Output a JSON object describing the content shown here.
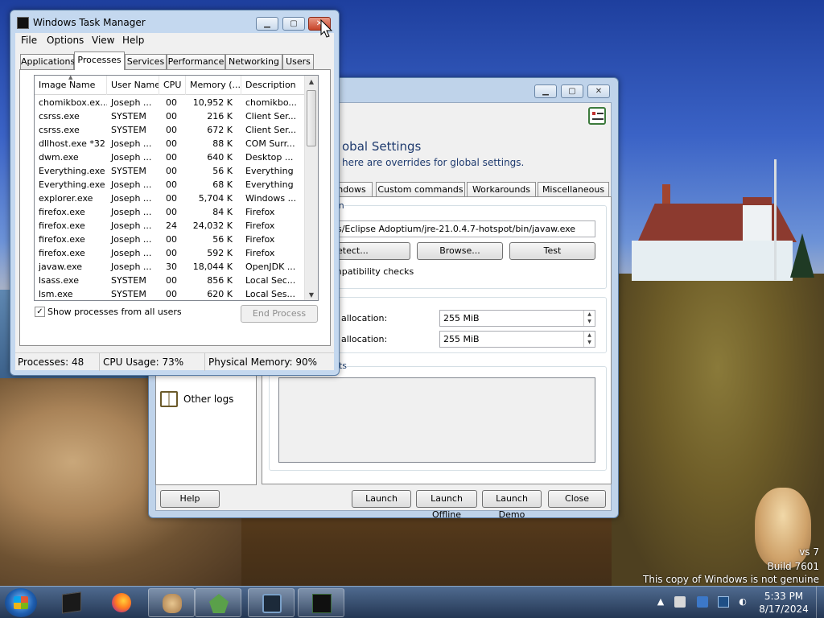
{
  "desktop": {
    "watermark_line1": "vs 7",
    "watermark_line2": "Build 7601",
    "watermark_line3": "This copy of Windows is not genuine"
  },
  "taskmanager": {
    "title": "Windows Task Manager",
    "menu": [
      "File",
      "Options",
      "View",
      "Help"
    ],
    "tabs": [
      "Applications",
      "Processes",
      "Services",
      "Performance",
      "Networking",
      "Users"
    ],
    "active_tab": "Processes",
    "columns": [
      "Image Name",
      "User Name",
      "CPU",
      "Memory (...",
      "Description"
    ],
    "rows": [
      [
        "chomikbox.ex...",
        "Joseph ...",
        "00",
        "10,952 K",
        "chomikbo..."
      ],
      [
        "csrss.exe",
        "SYSTEM",
        "00",
        "216 K",
        "Client Ser..."
      ],
      [
        "csrss.exe",
        "SYSTEM",
        "00",
        "672 K",
        "Client Ser..."
      ],
      [
        "dllhost.exe *32",
        "Joseph ...",
        "00",
        "88 K",
        "COM Surr..."
      ],
      [
        "dwm.exe",
        "Joseph ...",
        "00",
        "640 K",
        "Desktop ..."
      ],
      [
        "Everything.exe",
        "SYSTEM",
        "00",
        "56 K",
        "Everything"
      ],
      [
        "Everything.exe",
        "Joseph ...",
        "00",
        "68 K",
        "Everything"
      ],
      [
        "explorer.exe",
        "Joseph ...",
        "00",
        "5,704 K",
        "Windows ..."
      ],
      [
        "firefox.exe",
        "Joseph ...",
        "00",
        "84 K",
        "Firefox"
      ],
      [
        "firefox.exe",
        "Joseph ...",
        "24",
        "24,032 K",
        "Firefox"
      ],
      [
        "firefox.exe",
        "Joseph ...",
        "00",
        "56 K",
        "Firefox"
      ],
      [
        "firefox.exe",
        "Joseph ...",
        "00",
        "592 K",
        "Firefox"
      ],
      [
        "javaw.exe",
        "Joseph ...",
        "30",
        "18,044 K",
        "OpenJDK ..."
      ],
      [
        "lsass.exe",
        "SYSTEM",
        "00",
        "856 K",
        "Local Sec..."
      ],
      [
        "lsm.exe",
        "SYSTEM",
        "00",
        "620 K",
        "Local Ses..."
      ]
    ],
    "show_all_label": "Show processes from all users",
    "show_all_checked": "✓",
    "end_process": "End Process",
    "status": {
      "processes": "Processes: 48",
      "cpu": "CPU Usage: 73%",
      "memory": "Physical Memory: 90%"
    }
  },
  "launcher": {
    "heading": "obal Settings",
    "subheading": "here are overrides for global settings.",
    "tabs": [
      "ndows",
      "Custom commands",
      "Workarounds",
      "Miscellaneous"
    ],
    "java_group": "on",
    "java_path": "s/Eclipse Adoptium/jre-21.0.4.7-hotspot/bin/javaw.exe",
    "detect_button": "etect...",
    "browse_button": "Browse...",
    "test_button": "Test",
    "compat_label": "mpatibility checks",
    "min_label": "y allocation:",
    "min_value": "255 MiB",
    "max_label": "y allocation:",
    "max_value": "255 MiB",
    "args_group": "nts",
    "sidebar_item": "Other logs",
    "help_button": "Help",
    "launch_button": "Launch",
    "launch_offline_button": "Launch Offline",
    "launch_demo_button": "Launch Demo",
    "close_button": "Close"
  },
  "taskbar": {
    "time": "5:33 PM",
    "date": "8/17/2024"
  }
}
